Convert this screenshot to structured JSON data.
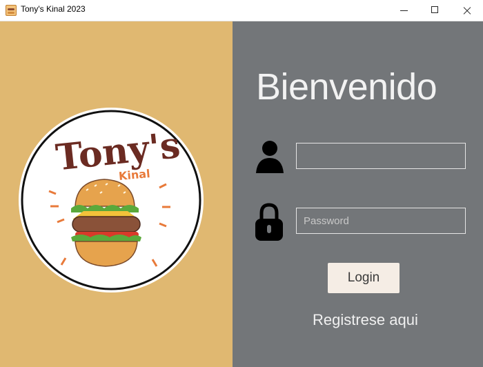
{
  "window": {
    "title": "Tony's Kinal 2023",
    "controls": [
      "minimize-icon",
      "maximize-icon",
      "close-icon"
    ]
  },
  "brand": {
    "logo_text": "Tony's",
    "logo_subtext": "Kinal"
  },
  "login": {
    "welcome": "Bienvenido",
    "username": {
      "value": "",
      "placeholder": ""
    },
    "password": {
      "value": "",
      "placeholder": "Password"
    },
    "login_label": "Login",
    "register_label": "Registrese aqui"
  },
  "colors": {
    "left_panel": "#e0b871",
    "right_panel": "#737679",
    "button_bg": "#f5ede5",
    "text_light": "#f2f2f2"
  }
}
